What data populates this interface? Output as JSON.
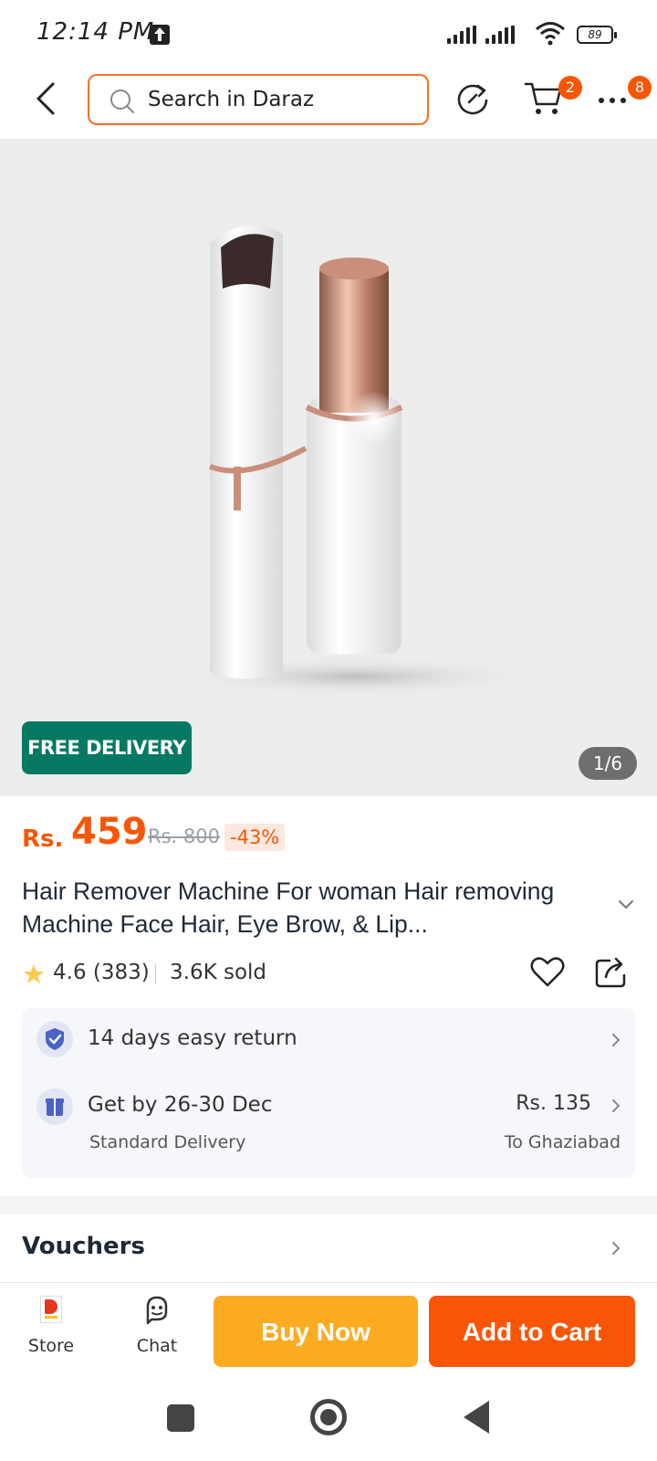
{
  "status_bar": {
    "time": "12:14 PM",
    "battery": "89",
    "icons": [
      "upload-icon",
      "signal-icon",
      "signal-icon",
      "wifi-icon",
      "battery-icon"
    ]
  },
  "header": {
    "search_placeholder": "Search in Daraz",
    "cart_count": "2",
    "more_count": "8",
    "accent_color": "#f57224"
  },
  "gallery": {
    "badge": "FREE DELIVERY",
    "counter": "1/6",
    "badge_color": "#067962"
  },
  "product": {
    "currency": "Rs.",
    "price": "459",
    "original_price": "Rs. 800",
    "discount": "-43%",
    "title": "Hair Remover Machine For woman Hair removing Machine Face Hair, Eye Brow, & Lip...",
    "rating": "4.6 (383)",
    "sold": "3.6K sold",
    "price_color": "#f85606"
  },
  "info": {
    "return_policy": "14 days easy return",
    "delivery_date": "Get by 26-30 Dec",
    "delivery_type": "Standard Delivery",
    "delivery_fee": "Rs. 135",
    "delivery_to": "To Ghaziabad"
  },
  "vouchers": {
    "title": "Vouchers"
  },
  "action_bar": {
    "store_label": "Store",
    "chat_label": "Chat",
    "buy_now_label": "Buy Now",
    "add_to_cart_label": "Add to Cart",
    "buy_now_color": "#fdab20",
    "add_to_cart_color": "#f85606"
  }
}
